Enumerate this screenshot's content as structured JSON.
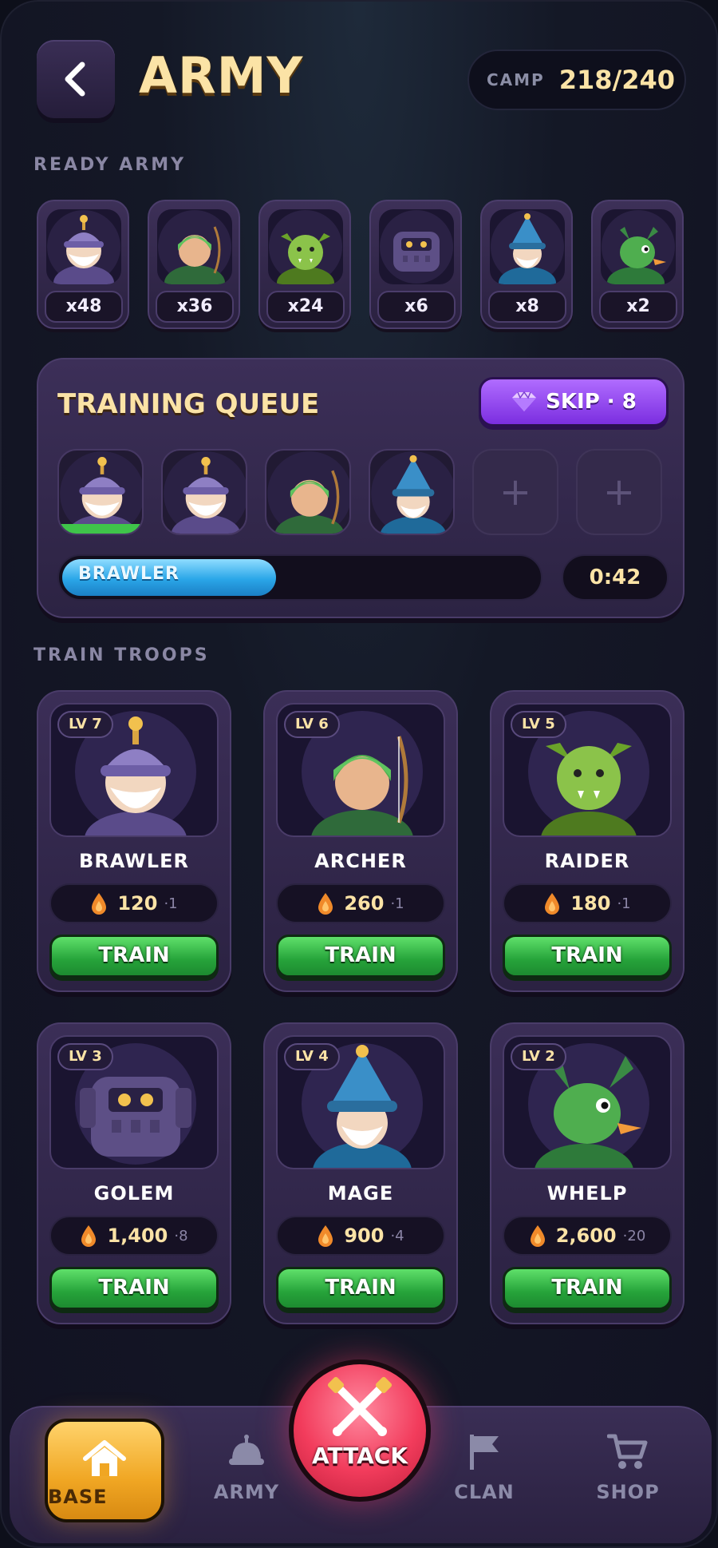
{
  "header": {
    "title": "ARMY",
    "camp_label": "CAMP",
    "camp_value": "218/240"
  },
  "ready_army": {
    "label": "READY ARMY",
    "units": [
      {
        "unit": "brawler",
        "count": "x48"
      },
      {
        "unit": "archer",
        "count": "x36"
      },
      {
        "unit": "raider",
        "count": "x24"
      },
      {
        "unit": "golem",
        "count": "x6"
      },
      {
        "unit": "mage",
        "count": "x8"
      },
      {
        "unit": "whelp",
        "count": "x2"
      }
    ]
  },
  "training_queue": {
    "title": "TRAINING QUEUE",
    "skip_label": "SKIP · 8",
    "slots": [
      "brawler",
      "brawler",
      "archer",
      "mage",
      "empty",
      "empty"
    ],
    "empty_slot_symbol": "+",
    "current_unit": "BRAWLER",
    "progress": 0.45,
    "timer": "0:42"
  },
  "train_troops": {
    "label": "TRAIN TROOPS",
    "troops": [
      {
        "name": "BRAWLER",
        "level": "LV 7",
        "cost": "120",
        "space": "·1",
        "button": "TRAIN"
      },
      {
        "name": "ARCHER",
        "level": "LV 6",
        "cost": "260",
        "space": "·1",
        "button": "TRAIN"
      },
      {
        "name": "RAIDER",
        "level": "LV 5",
        "cost": "180",
        "space": "·1",
        "button": "TRAIN"
      },
      {
        "name": "GOLEM",
        "level": "LV 3",
        "cost": "1,400",
        "space": "·8",
        "button": "TRAIN"
      },
      {
        "name": "MAGE",
        "level": "LV 4",
        "cost": "900",
        "space": "·4",
        "button": "TRAIN"
      },
      {
        "name": "WHELP",
        "level": "LV 2",
        "cost": "2,600",
        "space": "·20",
        "button": "TRAIN"
      }
    ]
  },
  "nav": {
    "base": "BASE",
    "army": "ARMY",
    "attack": "ATTACK",
    "clan": "CLAN",
    "shop": "SHOP"
  },
  "colors": {
    "accent_gold": "#fbe3a6",
    "train_green": "#26a33a",
    "skip_purple": "#7b2ee0",
    "progress_blue": "#2aa6e8",
    "attack_red": "#f23c5c",
    "base_orange": "#f0a623"
  }
}
